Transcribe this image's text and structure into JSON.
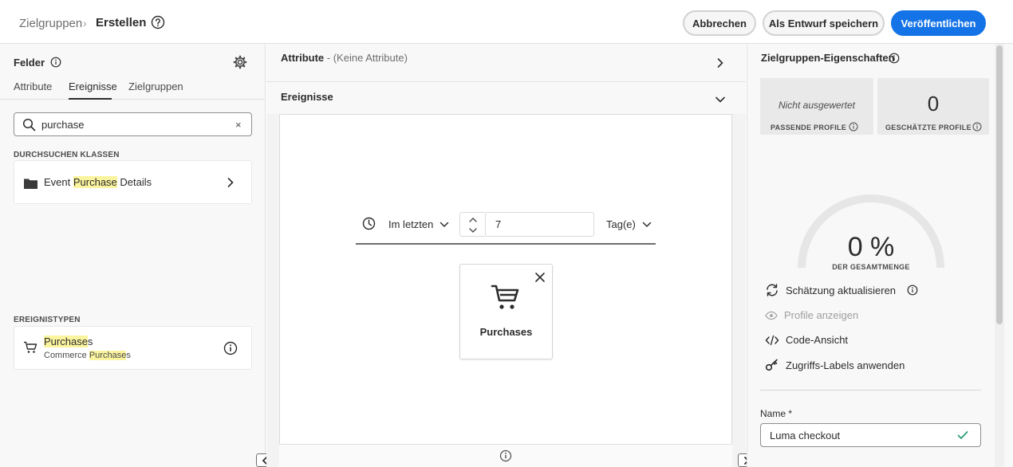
{
  "header": {
    "breadcrumb_parent": "Zielgruppen",
    "breadcrumb_sep": "›",
    "breadcrumb_current": "Erstellen",
    "cancel_label": "Abbrechen",
    "draft_label": "Als Entwurf speichern",
    "publish_label": "Veröffentlichen"
  },
  "left": {
    "title": "Felder",
    "tabs": [
      {
        "label": "Attribute",
        "active": false
      },
      {
        "label": "Ereignisse",
        "active": true
      },
      {
        "label": "Zielgruppen",
        "active": false
      }
    ],
    "search": {
      "value": "purchase",
      "clear": "×"
    },
    "browse_label": "DURCHSUCHEN KLASSEN",
    "browse_item": {
      "pre": "Event ",
      "hl": "Purchase",
      "post": " Details"
    },
    "event_types_label": "EREIGNISTYPEN",
    "event_item": {
      "title_hl": "Purchase",
      "title_post": "s",
      "sub_pre": "Commerce ",
      "sub_hl": "Purchase",
      "sub_post": "s"
    }
  },
  "center": {
    "attributes_title": "Attribute",
    "attributes_sub": " - (Keine Attribute)",
    "events_title": "Ereignisse",
    "time_mode": "Im letzten",
    "time_value": "7",
    "time_unit": "Tag(e)",
    "event_card_label": "Purchases"
  },
  "right": {
    "title": "Zielgruppen-Eigenschaften",
    "matching_value": "Nicht ausgewertet",
    "matching_label": "PASSENDE PROFILE",
    "estimated_value": "0",
    "estimated_label": "GESCHÄTZTE PROFILE",
    "gauge_value": "0 %",
    "gauge_label": "DER GESAMTMENGE",
    "gauge_fraction": 0,
    "actions": {
      "refresh": "Schätzung aktualisieren",
      "view_profiles": "Profile anzeigen",
      "code_view": "Code-Ansicht",
      "access_labels": "Zugriffs-Labels anwenden"
    },
    "name_label": "Name",
    "required_mark": "*",
    "name_value": "Luma checkout"
  },
  "colors": {
    "accent": "#1473e6",
    "highlight": "#fbf49f",
    "success": "#2d9d78"
  }
}
